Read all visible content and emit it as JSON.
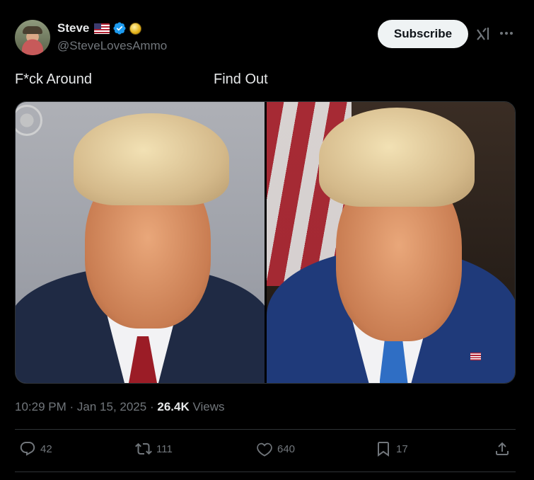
{
  "author": {
    "display_name": "Steve",
    "handle": "@SteveLovesAmmo"
  },
  "header": {
    "subscribe_label": "Subscribe"
  },
  "post": {
    "caption_left": "F*ck Around",
    "caption_right": "Find Out",
    "time": "10:29 PM",
    "separator": "·",
    "date": "Jan 15, 2025",
    "views_count": "26.4K",
    "views_label": "Views"
  },
  "actions": {
    "replies": "42",
    "reposts": "111",
    "likes": "640",
    "bookmarks": "17"
  },
  "icons": [
    "verified-icon",
    "grok-icon",
    "more-icon",
    "reply-icon",
    "repost-icon",
    "like-icon",
    "bookmark-icon",
    "share-icon"
  ],
  "colors": {
    "background": "#000000",
    "text": "#e7e9ea",
    "muted": "#71767b",
    "verified": "#1d9bf0",
    "divider": "#2f3336"
  }
}
